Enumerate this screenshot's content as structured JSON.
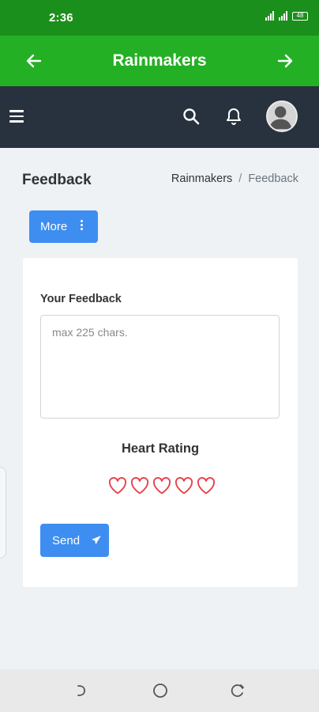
{
  "status_bar": {
    "time": "2:36",
    "battery": "48"
  },
  "app_bar": {
    "title": "Rainmakers"
  },
  "page": {
    "title": "Feedback"
  },
  "breadcrumb": {
    "items": [
      "Rainmakers",
      "Feedback"
    ],
    "separator": "/"
  },
  "more_button": {
    "label": "More"
  },
  "feedback": {
    "label": "Your Feedback",
    "placeholder": "max 225 chars.",
    "value": ""
  },
  "rating": {
    "label": "Heart Rating",
    "hearts": 5,
    "selected": 0
  },
  "send_button": {
    "label": "Send"
  },
  "colors": {
    "status_bar": "#1b8f1b",
    "app_bar": "#24b024",
    "top_nav": "#28323e",
    "primary": "#3d8ef0",
    "heart": "#e8414b"
  }
}
